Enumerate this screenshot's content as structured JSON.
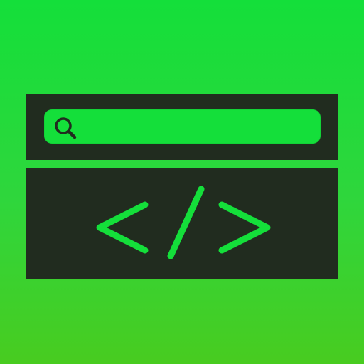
{
  "search": {
    "value": "",
    "placeholder": "",
    "icon": "search-icon"
  },
  "editor": {
    "icon": "code-brackets-icon"
  },
  "colors": {
    "background_top": "#14df3a",
    "background_bottom": "#48cc20",
    "panel": "#212c1f",
    "accent": "#14df3a"
  }
}
